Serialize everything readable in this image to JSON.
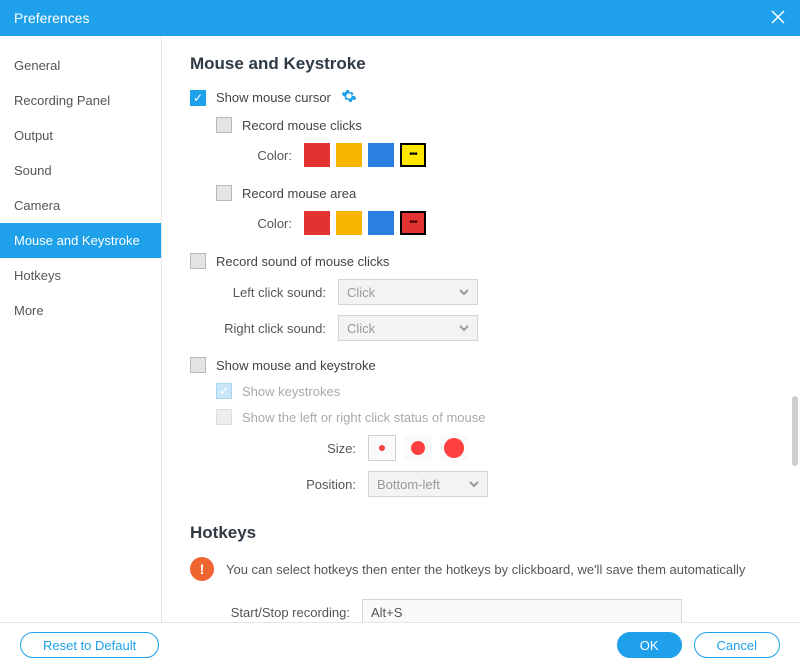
{
  "window": {
    "title": "Preferences"
  },
  "sidebar": {
    "items": [
      {
        "label": "General"
      },
      {
        "label": "Recording Panel"
      },
      {
        "label": "Output"
      },
      {
        "label": "Sound"
      },
      {
        "label": "Camera"
      },
      {
        "label": "Mouse and Keystroke"
      },
      {
        "label": "Hotkeys"
      },
      {
        "label": "More"
      }
    ],
    "active_index": 5
  },
  "section": {
    "mouse_keystroke": {
      "heading": "Mouse and Keystroke",
      "show_cursor": {
        "label": "Show mouse cursor",
        "checked": true
      },
      "record_clicks": {
        "label": "Record mouse clicks",
        "checked": false,
        "color_label": "Color:",
        "swatches": [
          "#e23232",
          "#f8b500",
          "#2a7fe0",
          "#ffe600"
        ],
        "selected_index": 3
      },
      "record_area": {
        "label": "Record mouse area",
        "checked": false,
        "color_label": "Color:",
        "swatches": [
          "#e23232",
          "#f8b500",
          "#2a7fe0",
          "#e23232"
        ],
        "selected_index": 3
      },
      "record_sound": {
        "label": "Record sound of mouse clicks",
        "checked": false,
        "left_label": "Left click sound:",
        "left_value": "Click",
        "right_label": "Right click sound:",
        "right_value": "Click"
      },
      "show_mk": {
        "label": "Show mouse and keystroke",
        "checked": false,
        "show_keystrokes": {
          "label": "Show keystrokes",
          "checked": true
        },
        "show_lr_status": {
          "label": "Show the left or right click status of mouse",
          "checked": false
        },
        "size_label": "Size:",
        "size_options": [
          6,
          14,
          20
        ],
        "size_selected_index": 0,
        "position_label": "Position:",
        "position_value": "Bottom-left"
      }
    },
    "hotkeys": {
      "heading": "Hotkeys",
      "info": "You can select hotkeys then enter the hotkeys by clickboard, we'll save them automatically",
      "start_stop_label": "Start/Stop recording:",
      "start_stop_value": "Alt+S"
    }
  },
  "footer": {
    "reset": "Reset to Default",
    "ok": "OK",
    "cancel": "Cancel"
  },
  "icons": {
    "ellipsis": "•••"
  }
}
